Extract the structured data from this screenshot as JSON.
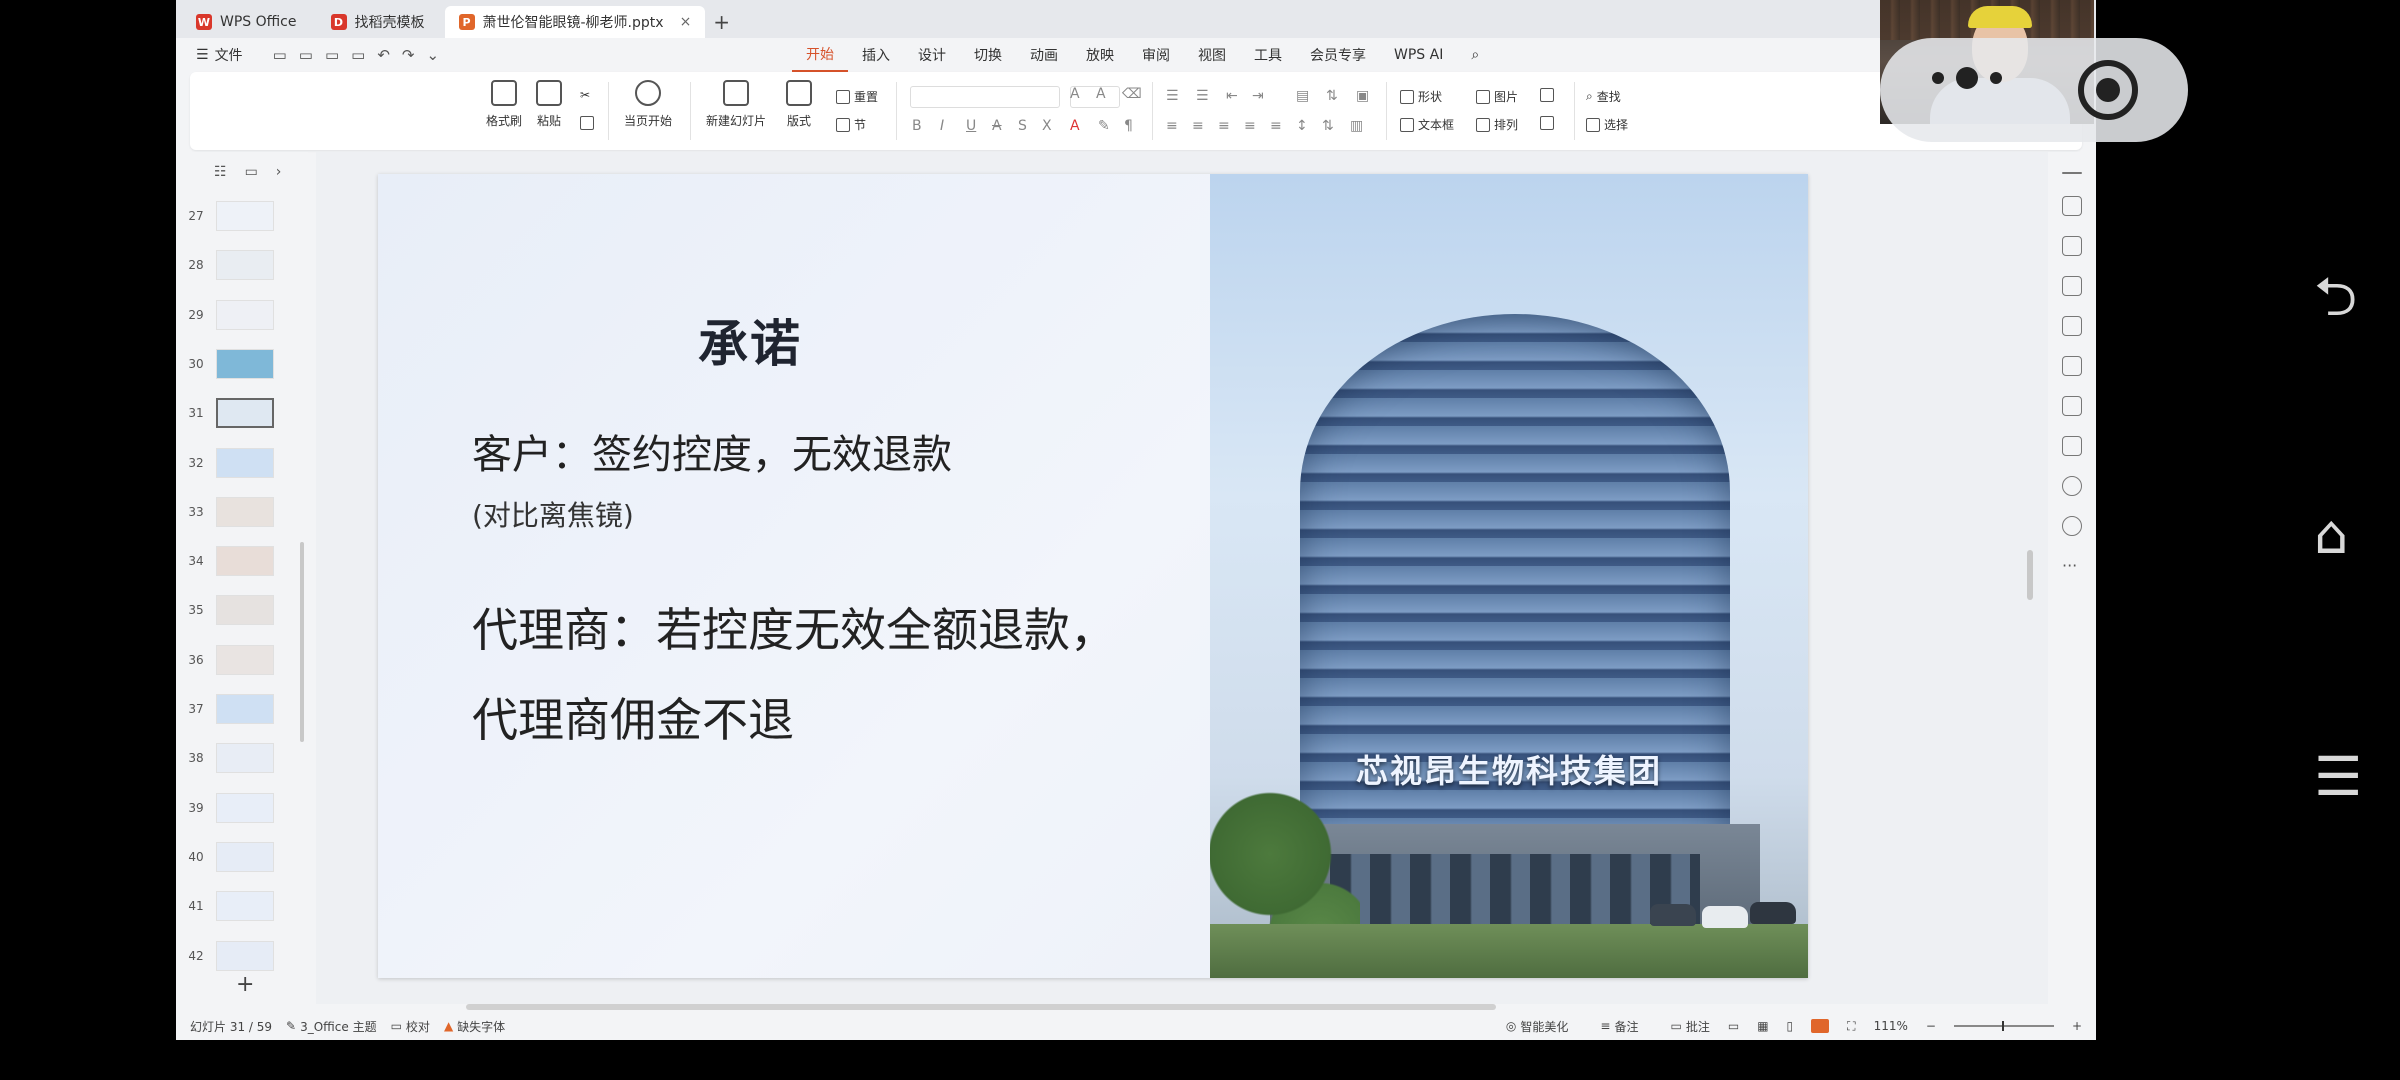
{
  "tabs": [
    {
      "label": "WPS Office",
      "badge": "W",
      "color": "#d9372b"
    },
    {
      "label": "找稻壳模板",
      "badge": "D",
      "color": "#d9372b"
    },
    {
      "label": "萧世伦智能眼镜-柳老师.pptx",
      "badge": "P",
      "color": "#e0662a",
      "close": "×"
    }
  ],
  "menu": {
    "file": "文件",
    "items": [
      "开始",
      "插入",
      "设计",
      "切换",
      "动画",
      "放映",
      "审阅",
      "视图",
      "工具",
      "会员专享",
      "WPS AI"
    ],
    "active_index": 0
  },
  "ribbon": {
    "format_painter": "格式刷",
    "paste": "粘贴",
    "from_current": "当页开始",
    "new_slide": "新建幻灯片",
    "layout": "版式",
    "section": "节",
    "reset": "重置",
    "shape": "形状",
    "picture": "图片",
    "textbox": "文本框",
    "arrange": "排列",
    "find": "查找",
    "select": "选择"
  },
  "thumbnails": {
    "numbers": [
      "27",
      "28",
      "29",
      "30",
      "31",
      "32",
      "33",
      "34",
      "35",
      "36",
      "37",
      "38",
      "39",
      "40",
      "41",
      "42"
    ],
    "selected": "31"
  },
  "slide": {
    "title": "承诺",
    "line1": "客户：签约控度，无效退款",
    "line2": "(对比离焦镜)",
    "line3": "代理商：若控度无效全额退款，",
    "line4": "代理商佣金不退",
    "photo_sign": "芯视昂生物科技集团"
  },
  "status": {
    "slide_count": "幻灯片 31 / 59",
    "theme": "3_Office 主题",
    "proofread": "校对",
    "missing_font": "缺失字体",
    "smart_beautify": "智能美化",
    "notes": "备注",
    "comments": "批注",
    "zoom": "111%"
  },
  "icons": {
    "back": "back-icon",
    "home": "home-icon",
    "menu": "menu-icon"
  }
}
